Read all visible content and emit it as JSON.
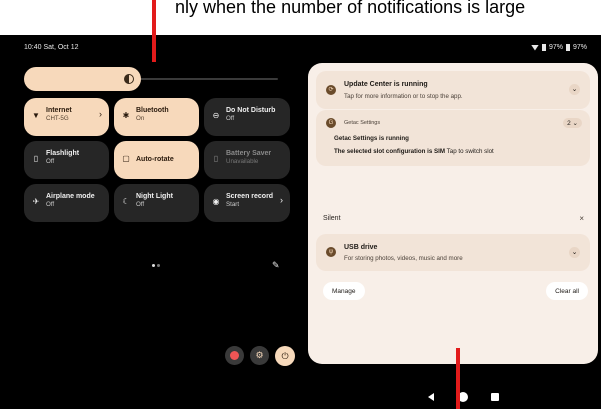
{
  "caption": {
    "text": "nly      when the number of notifications is large"
  },
  "status_bar": {
    "time": "10:40  Sat, Oct 12",
    "battery_text": "97%",
    "battery_text_2": "97%"
  },
  "brightness": {
    "level": 0.46
  },
  "tiles": [
    {
      "id": "internet",
      "label": "Internet",
      "sub": "CHT-5G",
      "state": "on",
      "icon": "wifi-icon",
      "glyph": "▼",
      "chevron": "›"
    },
    {
      "id": "bluetooth",
      "label": "Bluetooth",
      "sub": "On",
      "state": "on",
      "icon": "bluetooth-icon",
      "glyph": "✱",
      "chevron": ""
    },
    {
      "id": "dnd",
      "label": "Do Not Disturb",
      "sub": "Off",
      "state": "off",
      "icon": "dnd-icon",
      "glyph": "⊖",
      "chevron": ""
    },
    {
      "id": "flashlight",
      "label": "Flashlight",
      "sub": "Off",
      "state": "off",
      "icon": "flashlight-icon",
      "glyph": "▯",
      "chevron": ""
    },
    {
      "id": "autorotate",
      "label": "Auto-rotate",
      "sub": "",
      "state": "on",
      "icon": "rotate-icon",
      "glyph": "▢",
      "chevron": ""
    },
    {
      "id": "battery-saver",
      "label": "Battery Saver",
      "sub": "Unavailable",
      "state": "dim",
      "icon": "battery-saver-icon",
      "glyph": "▯",
      "chevron": ""
    },
    {
      "id": "airplane",
      "label": "Airplane mode",
      "sub": "Off",
      "state": "off",
      "icon": "airplane-icon",
      "glyph": "✈",
      "chevron": ""
    },
    {
      "id": "nightlight",
      "label": "Night Light",
      "sub": "Off",
      "state": "off",
      "icon": "night-light-icon",
      "glyph": "☾",
      "chevron": ""
    },
    {
      "id": "screenrecord",
      "label": "Screen record",
      "sub": "Start",
      "state": "off",
      "icon": "screen-record-icon",
      "glyph": "◉",
      "chevron": "›"
    }
  ],
  "notifications": {
    "update_center": {
      "title": "Update Center is running",
      "sub": "Tap for more information or to stop the app.",
      "chevron": "⌄"
    },
    "getac": {
      "app_name": "Getac Settings",
      "title": "Getac Settings is running",
      "body_bold": "The selected slot configuration is SIM",
      "body_rest": " Tap to switch slot",
      "count": "2 ⌄"
    },
    "silent_label": "Silent",
    "silent_close": "×",
    "usb": {
      "title": "USB drive",
      "sub": "For storing photos, videos, music and more",
      "chevron": "⌄"
    },
    "manage_label": "Manage",
    "clear_all_label": "Clear all"
  },
  "colors": {
    "accent": "#f7d9bb",
    "panel": "#f8efe8",
    "card": "#f2e4d8",
    "tile_off": "#262626",
    "annotation": "#e21b1b"
  }
}
